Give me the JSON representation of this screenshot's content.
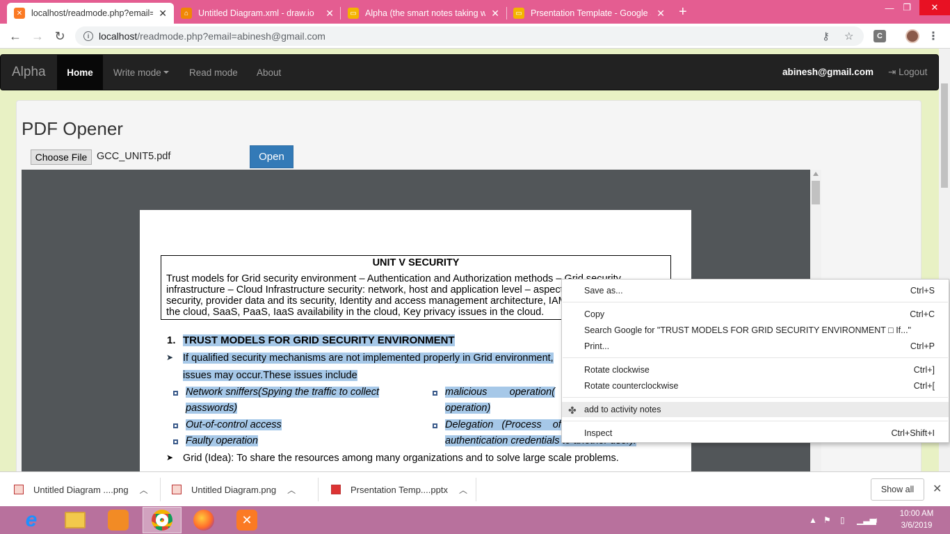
{
  "browser": {
    "tabs": [
      {
        "title": "localhost/readmode.php?email=a",
        "active": true,
        "icon": "xampp-icon"
      },
      {
        "title": "Untitled Diagram.xml - draw.io",
        "active": false,
        "icon": "drawio-icon"
      },
      {
        "title": "Alpha (the smart notes taking we",
        "active": false,
        "icon": "slides-icon"
      },
      {
        "title": "Prsentation Template - Google S",
        "active": false,
        "icon": "slides-icon"
      }
    ],
    "url_host": "localhost",
    "url_path": "/readmode.php?email=abinesh@gmail.com",
    "extension_label": "C"
  },
  "navbar": {
    "brand": "Alpha",
    "items": [
      {
        "label": "Home",
        "active": true
      },
      {
        "label": "Write mode",
        "dropdown": true
      },
      {
        "label": "Read mode"
      },
      {
        "label": "About"
      }
    ],
    "user_email": "abinesh@gmail.com",
    "logout_label": "Logout"
  },
  "main": {
    "title": "PDF Opener",
    "choose_file_label": "Choose File",
    "file_name": "GCC_UNIT5.pdf",
    "open_label": "Open"
  },
  "pdf": {
    "unit_title": "UNIT V SECURITY",
    "unit_lines": [
      "Trust models for Grid security environment – Authentication and Authorization methods – Grid security",
      "infrastructure – Cloud Infrastructure security: network, host and application level – aspects of data",
      "security, provider data and its security, Identity and access management architecture, IAM practices in",
      "the cloud, SaaS, PaaS, IaaS availability in the cloud, Key privacy issues in the cloud."
    ],
    "heading_num": "1.",
    "heading": "TRUST MODELS FOR GRID SECURITY ENVIRONMENT",
    "para1_a": "If qualified security mechanisms are not implemented properly in Grid environment,",
    "para1_b": "issues may occur.These issues include",
    "col1": [
      "Network sniffers(Spying the traffic to collect",
      "passwords)",
      "Out-of-control access",
      "Faulty operation"
    ],
    "col2": [
      "malicious        operation(",
      "operation)",
      "Delegation   (Process    of",
      "authentication credentials to another user)."
    ],
    "para2": "Grid (Idea): To share the resources among many organizations and to solve large scale problems."
  },
  "context_menu": {
    "items": [
      {
        "label": "Save as...",
        "shortcut": "Ctrl+S"
      },
      {
        "label": "Copy",
        "shortcut": "Ctrl+C"
      },
      {
        "label": "Search Google for \"TRUST MODELS FOR GRID SECURITY ENVIRONMENT  □ If...\"",
        "shortcut": ""
      },
      {
        "label": "Print...",
        "shortcut": "Ctrl+P"
      },
      {
        "label": "Rotate clockwise",
        "shortcut": "Ctrl+]"
      },
      {
        "label": "Rotate counterclockwise",
        "shortcut": "Ctrl+["
      },
      {
        "label": "add to activity notes",
        "shortcut": ""
      },
      {
        "label": "Inspect",
        "shortcut": "Ctrl+Shift+I"
      }
    ]
  },
  "downloads": {
    "items": [
      "Untitled Diagram ....png",
      "Untitled Diagram.png",
      "Prsentation Temp....pptx"
    ],
    "show_all_label": "Show all"
  },
  "taskbar": {
    "apps": [
      "internet-explorer",
      "file-explorer",
      "uc-browser",
      "chrome",
      "firefox",
      "xampp"
    ],
    "time": "10:00 AM",
    "date": "3/6/2019"
  },
  "colors": {
    "tabbar": "#e45d91",
    "navbar": "#222222",
    "primary_button": "#337ab7",
    "selection": "#a6c8e8",
    "taskbar": "#b8719d"
  }
}
